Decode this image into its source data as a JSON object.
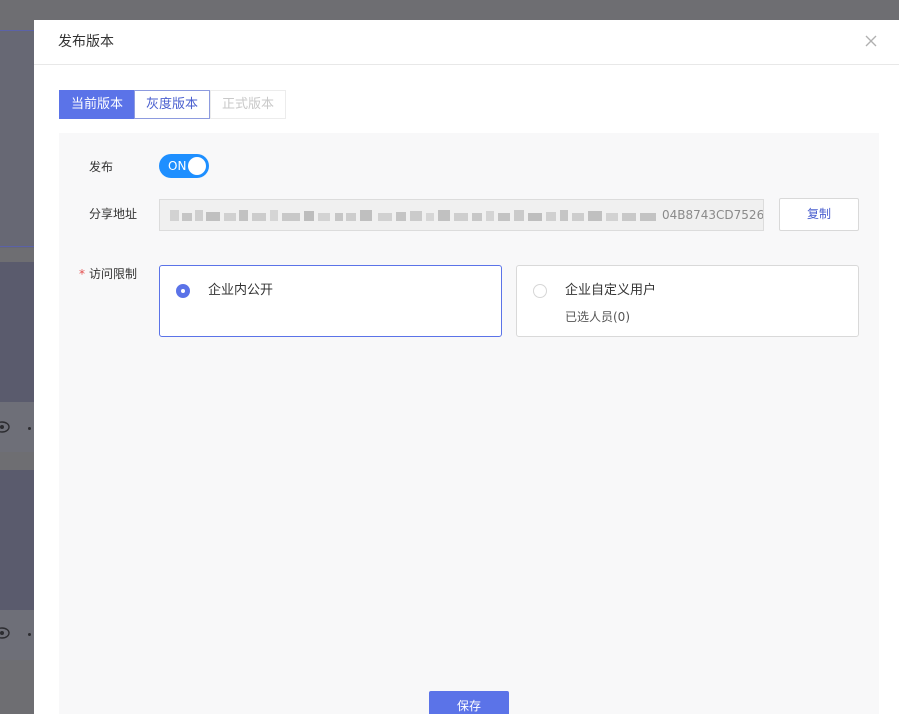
{
  "dialog": {
    "title": "发布版本",
    "close_icon": "close-icon"
  },
  "tabs": [
    {
      "label": "当前版本",
      "state": "active"
    },
    {
      "label": "灰度版本",
      "state": "normal"
    },
    {
      "label": "正式版本",
      "state": "disabled"
    }
  ],
  "form": {
    "publish_label": "发布",
    "publish_switch_text": "ON",
    "publish_enabled": true,
    "share_label": "分享地址",
    "share_url_visible_suffix": "04B8743CD7526",
    "copy_label": "复制",
    "access_label": "访问限制",
    "required_marker": "*",
    "access_options": [
      {
        "title": "企业内公开",
        "subtitle": "",
        "selected": true
      },
      {
        "title": "企业自定义用户",
        "subtitle": "已选人员(0)",
        "selected": false
      }
    ],
    "save_label": "保存"
  },
  "colors": {
    "primary": "#5b73e8",
    "switch_on": "#1e8fff",
    "required": "#e34d4d",
    "overlay": "#6e6e72"
  }
}
